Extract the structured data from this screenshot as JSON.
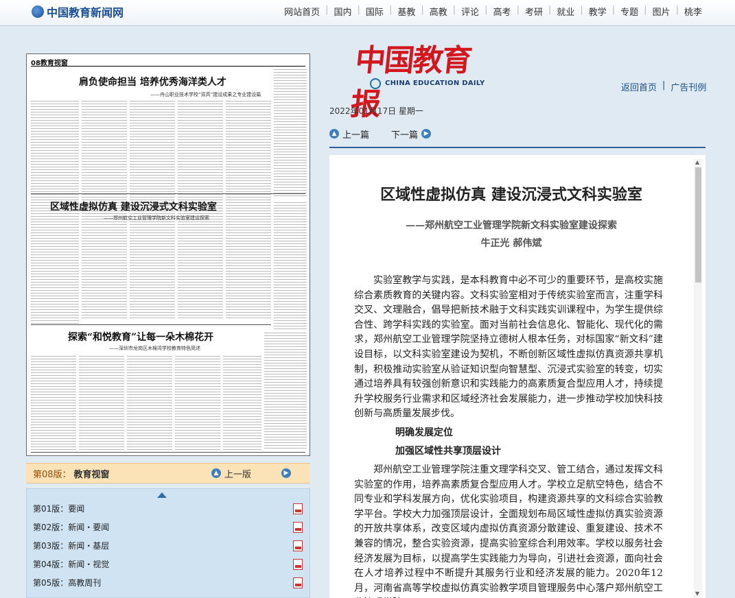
{
  "site": {
    "logo_text": "中国教育新闻网",
    "nav": [
      "网站首页",
      "国内",
      "国际",
      "基教",
      "高教",
      "评论",
      "高考",
      "考研",
      "就业",
      "教学",
      "专题",
      "图片",
      "桃李"
    ]
  },
  "paper_brand": {
    "name_cn": "中国教育报",
    "name_en": "CHINA EDUCATION DAILY"
  },
  "header_links": {
    "home": "返回首页",
    "sep": "|",
    "archive": "广告刊例"
  },
  "date_line": "2022年01月17日  星期一",
  "article_nav": {
    "prev": "上一篇",
    "next": "下一篇"
  },
  "thumbnail": {
    "page_label": "08教育视窗",
    "headline_1": "肩负使命担当   培养优秀海洋类人才",
    "subhead_1": "——舟山职业技术学校“双高”建设成果之专业建设篇",
    "headline_2": "区域性虚拟仿真   建设沉浸式文科实验室",
    "subhead_2": "——郑州航空工业管理学院新文科实验室建设探索",
    "headline_3": "探索“和悦教育”让每一朵木棉花开",
    "subhead_3": "——深圳市龙岗区木棉湾学校教育特色简述"
  },
  "current_page": {
    "label": "第08版：",
    "section": "教育视窗",
    "prev": "上一版"
  },
  "page_list": [
    {
      "label": "第01版：要闻"
    },
    {
      "label": "第02版：新闻・要闻"
    },
    {
      "label": "第03版：新闻・基层"
    },
    {
      "label": "第04版：新闻・视觉"
    },
    {
      "label": "第05版：高教周刊"
    }
  ],
  "article": {
    "title": "区域性虚拟仿真  建设沉浸式文科实验室",
    "subtitle": "——郑州航空工业管理学院新文科实验室建设探索",
    "authors": "牛正光  郝伟斌",
    "para_1": "实验室教学与实践，是本科教育中必不可少的重要环节，是高校实施综合素质教育的关键内容。文科实验室相对于传统实验室而言，注重学科交叉、文理融合，倡导把新技术融于文科实践实训课程中，为学生提供综合性、跨学科实践的实验室。面对当前社会信息化、智能化、现代化的需求，郑州航空工业管理学院坚持立德树人根本任务，对标国家“新文科”建设目标，以文科实验室建设为契机，不断创新区域性虚拟仿真资源共享机制，积极推动实验室从验证知识型向智慧型、沉浸式实验室的转变，切实通过培养具有较强创新意识和实践能力的高素质复合型应用人才，持续提升学校服务行业需求和区域经济社会发展能力，进一步推动学校加快科技创新与高质量发展步伐。",
    "heading_1": "明确发展定位",
    "heading_2": "加强区域性共享顶层设计",
    "para_2": "郑州航空工业管理学院注重文理学科交叉、管工结合，通过发挥文科实验室的作用，培养高素质复合型应用人才。学校立足航空特色，结合不同专业和学科发展方向，优化实验项目，构建资源共享的文科综合实验教学平台。学校大力加强顶层设计，全面规划布局区域性虚拟仿真实验资源的开放共享体系，改变区域内虚拟仿真资源分散建设、重复建设、技术不兼容的情况，整合实验资源，提高实验室综合利用效率。学校以服务社会经济发展为目标，以提高学生实践能力为导向，引进社会资源，面向社会在人才培养过程中不断提升其服务行业和经济发展的能力。2020年12月，河南省高等学校虚拟仿真实验教学项目管理服务中心落户郑州航空工业管理学院。"
  },
  "colors": {
    "nav_blue": "#1b4f94",
    "brand_red": "#d4171e",
    "current_page_bg": "#fbe2b7",
    "list_bg": "#cfe3f3"
  }
}
